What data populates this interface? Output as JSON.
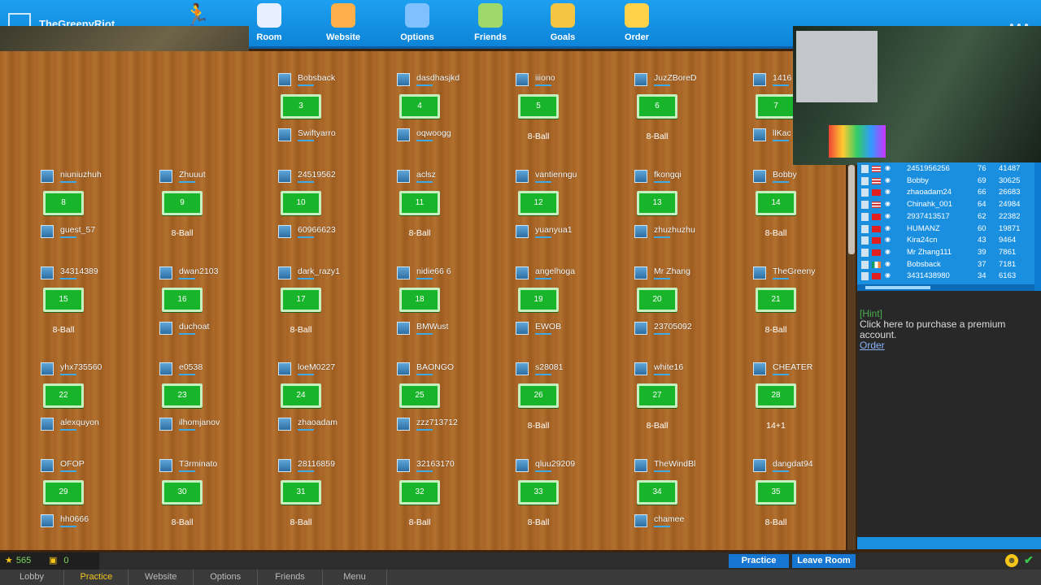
{
  "app": {
    "title": "TheGreenyRiot"
  },
  "nav": [
    {
      "label": "Room",
      "icon": "gamepad-icon",
      "color": "#e8f0ff"
    },
    {
      "label": "Website",
      "icon": "house-icon",
      "color": "#ffb04a"
    },
    {
      "label": "Options",
      "icon": "gear-icon",
      "color": "#7fc0ff"
    },
    {
      "label": "Friends",
      "icon": "friends-icon",
      "color": "#9fd86a"
    },
    {
      "label": "Goals",
      "icon": "chart-icon",
      "color": "#f4c542"
    },
    {
      "label": "Order",
      "icon": "order-icon",
      "color": "#ffd24a"
    }
  ],
  "tables": [
    {
      "num": "3",
      "top": "Bobsback",
      "bottom": "Swiftyarro",
      "mode": ""
    },
    {
      "num": "4",
      "top": "dasdhasjkd",
      "bottom": "oqwoogg",
      "mode": ""
    },
    {
      "num": "5",
      "top": "iiiono",
      "bottom": "",
      "mode": "8-Ball"
    },
    {
      "num": "6",
      "top": "JuzZBoreD",
      "bottom": "",
      "mode": "8-Ball"
    },
    {
      "num": "7",
      "top": "1416",
      "bottom": "llKac",
      "mode": ""
    },
    {
      "num": "8",
      "top": "niuniuzhuh",
      "bottom": "guest_57",
      "mode": ""
    },
    {
      "num": "9",
      "top": "Zhuuut",
      "bottom": "",
      "mode": "8-Ball"
    },
    {
      "num": "10",
      "top": "24519562",
      "bottom": "60966623",
      "mode": ""
    },
    {
      "num": "11",
      "top": "aclsz",
      "bottom": "",
      "mode": "8-Ball"
    },
    {
      "num": "12",
      "top": "vantienngu",
      "bottom": "yuanyua1",
      "mode": ""
    },
    {
      "num": "13",
      "top": "fkongqi",
      "bottom": "zhuzhuzhu",
      "mode": ""
    },
    {
      "num": "14",
      "top": "Bobby",
      "bottom": "",
      "mode": "8-Ball"
    },
    {
      "num": "15",
      "top": "34314389",
      "bottom": "",
      "mode": "8-Ball"
    },
    {
      "num": "16",
      "top": "dwan2103",
      "bottom": "duchoat",
      "mode": ""
    },
    {
      "num": "17",
      "top": "dark_razy1",
      "bottom": "",
      "mode": "8-Ball"
    },
    {
      "num": "18",
      "top": "nidie66 6",
      "bottom": "BMWust",
      "mode": ""
    },
    {
      "num": "19",
      "top": "angelhoga",
      "bottom": "EWOB",
      "mode": ""
    },
    {
      "num": "20",
      "top": "Mr Zhang",
      "bottom": "23705092",
      "mode": ""
    },
    {
      "num": "21",
      "top": "TheGreeny",
      "bottom": "",
      "mode": "8-Ball"
    },
    {
      "num": "22",
      "top": "yhx735560",
      "bottom": "alexquyon",
      "mode": ""
    },
    {
      "num": "23",
      "top": "e0538",
      "bottom": "ilhomjanov",
      "mode": ""
    },
    {
      "num": "24",
      "top": "loeM0227",
      "bottom": "zhaoadam",
      "mode": ""
    },
    {
      "num": "25",
      "top": "BAONGO",
      "bottom": "zzz713712",
      "mode": ""
    },
    {
      "num": "26",
      "top": "s28081",
      "bottom": "",
      "mode": "8-Ball"
    },
    {
      "num": "27",
      "top": "white16",
      "bottom": "",
      "mode": "8-Ball"
    },
    {
      "num": "28",
      "top": "CHEATER",
      "bottom": "",
      "mode": "14+1"
    },
    {
      "num": "29",
      "top": "OFOP",
      "bottom": "hh0666",
      "mode": ""
    },
    {
      "num": "30",
      "top": "T3rminato",
      "bottom": "",
      "mode": "8-Ball"
    },
    {
      "num": "31",
      "top": "28116859",
      "bottom": "",
      "mode": "8-Ball"
    },
    {
      "num": "32",
      "top": "32163170",
      "bottom": "",
      "mode": "8-Ball"
    },
    {
      "num": "33",
      "top": "qluu29209",
      "bottom": "",
      "mode": "8-Ball"
    },
    {
      "num": "34",
      "top": "TheWindBl",
      "bottom": "chamee",
      "mode": ""
    },
    {
      "num": "35",
      "top": "dangdat94",
      "bottom": "",
      "mode": "8-Ball"
    }
  ],
  "ranking": [
    {
      "name": "2451956256",
      "score": "76",
      "points": "41487",
      "flag": "us"
    },
    {
      "name": "Bobby",
      "score": "69",
      "points": "30625",
      "flag": "us"
    },
    {
      "name": "zhaoadam24",
      "score": "66",
      "points": "26683",
      "flag": "cn"
    },
    {
      "name": "Chinahk_001",
      "score": "64",
      "points": "24984",
      "flag": "us"
    },
    {
      "name": "2937413517",
      "score": "62",
      "points": "22382",
      "flag": "cn"
    },
    {
      "name": "HUMANZ",
      "score": "60",
      "points": "19871",
      "flag": "cn"
    },
    {
      "name": "Kira24cn",
      "score": "43",
      "points": "9464",
      "flag": "cn"
    },
    {
      "name": "Mr Zhang111",
      "score": "39",
      "points": "7861",
      "flag": "cn"
    },
    {
      "name": "Bobsback",
      "score": "37",
      "points": "7181",
      "flag": "ie"
    },
    {
      "name": "3431438980",
      "score": "34",
      "points": "6163",
      "flag": "cn"
    }
  ],
  "hint": {
    "title": "[Hint]",
    "text": "Click here to purchase a premium account.",
    "link": "Order"
  },
  "status": {
    "stars": "565",
    "gold": "0"
  },
  "actions": {
    "practice": "Practice",
    "leave": "Leave Room"
  },
  "tabs": [
    "Lobby",
    "Practice",
    "Website",
    "Options",
    "Friends",
    "Menu"
  ],
  "active_tab": "Practice"
}
